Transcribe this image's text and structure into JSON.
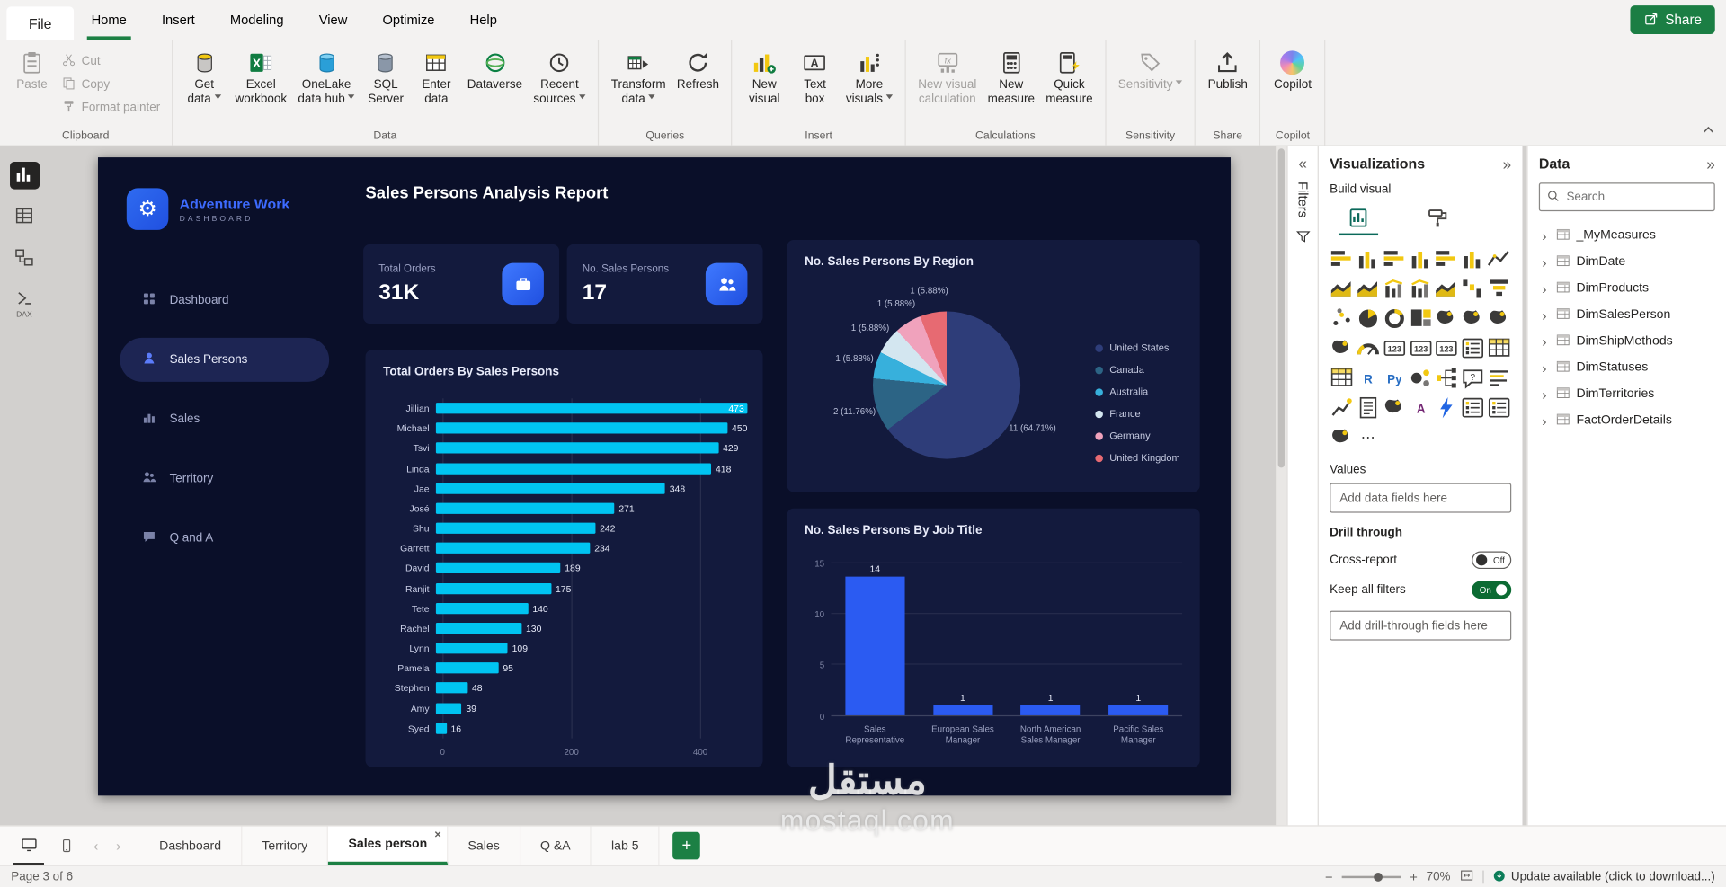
{
  "menubar": {
    "file_label": "File",
    "items": [
      "Home",
      "Insert",
      "Modeling",
      "View",
      "Optimize",
      "Help"
    ],
    "active_item": "Home",
    "share_label": "Share"
  },
  "ribbon": {
    "groups": [
      {
        "label": "Clipboard",
        "layout": "clipboard",
        "items": [
          {
            "label": "Paste",
            "icon": "paste",
            "disabled": true,
            "large": true
          },
          {
            "label": "Cut",
            "icon": "cut",
            "disabled": true
          },
          {
            "label": "Copy",
            "icon": "copy",
            "disabled": true
          },
          {
            "label": "Format painter",
            "icon": "format-painter",
            "disabled": true
          }
        ]
      },
      {
        "label": "Data",
        "items": [
          {
            "label": "Get\ndata",
            "icon": "get-data",
            "dropdown": true
          },
          {
            "label": "Excel\nworkbook",
            "icon": "excel"
          },
          {
            "label": "OneLake\ndata hub",
            "icon": "onelake",
            "dropdown": true
          },
          {
            "label": "SQL\nServer",
            "icon": "sql-server"
          },
          {
            "label": "Enter\ndata",
            "icon": "enter-data"
          },
          {
            "label": "Dataverse",
            "icon": "dataverse"
          },
          {
            "label": "Recent\nsources",
            "icon": "recent-sources",
            "dropdown": true
          }
        ]
      },
      {
        "label": "Queries",
        "items": [
          {
            "label": "Transform\ndata",
            "icon": "transform-data",
            "dropdown": true
          },
          {
            "label": "Refresh",
            "icon": "refresh"
          }
        ]
      },
      {
        "label": "Insert",
        "items": [
          {
            "label": "New\nvisual",
            "icon": "new-visual"
          },
          {
            "label": "Text\nbox",
            "icon": "text-box"
          },
          {
            "label": "More\nvisuals",
            "icon": "more-visuals",
            "dropdown": true
          }
        ]
      },
      {
        "label": "Calculations",
        "items": [
          {
            "label": "New visual\ncalculation",
            "icon": "new-visual-calculation",
            "disabled": true
          },
          {
            "label": "New\nmeasure",
            "icon": "new-measure"
          },
          {
            "label": "Quick\nmeasure",
            "icon": "quick-measure"
          }
        ]
      },
      {
        "label": "Sensitivity",
        "items": [
          {
            "label": "Sensitivity",
            "icon": "sensitivity",
            "disabled": true,
            "dropdown": true
          }
        ]
      },
      {
        "label": "Share",
        "items": [
          {
            "label": "Publish",
            "icon": "publish"
          }
        ]
      },
      {
        "label": "Copilot",
        "items": [
          {
            "label": "Copilot",
            "icon": "copilot"
          }
        ]
      }
    ]
  },
  "view_rail": {
    "items": [
      {
        "name": "report-view",
        "active": true
      },
      {
        "name": "table-view"
      },
      {
        "name": "model-view"
      },
      {
        "name": "dax-query-view",
        "label": "DAX"
      }
    ]
  },
  "dashboard": {
    "brand": {
      "title": "Adventure Work",
      "subtitle": "DASHBOARD"
    },
    "nav": [
      {
        "label": "Dashboard",
        "icon": "grid"
      },
      {
        "label": "Sales Persons",
        "icon": "person",
        "active": true
      },
      {
        "label": "Sales",
        "icon": "chart"
      },
      {
        "label": "Territory",
        "icon": "territory"
      },
      {
        "label": "Q and A",
        "icon": "chat"
      }
    ],
    "title": "Sales Persons Analysis Report",
    "kpis": [
      {
        "label": "Total Orders",
        "value": "31K",
        "icon": "briefcase"
      },
      {
        "label": "No. Sales Persons",
        "value": "17",
        "icon": "people"
      }
    ]
  },
  "chart_data": [
    {
      "type": "bar",
      "orientation": "horizontal",
      "title": "Total Orders By Sales Persons",
      "categories": [
        "Jillian",
        "Michael",
        "Tsvi",
        "Linda",
        "Jae",
        "José",
        "Shu",
        "Garrett",
        "David",
        "Ranjit",
        "Tete",
        "Rachel",
        "Lynn",
        "Pamela",
        "Stephen",
        "Amy",
        "Syed"
      ],
      "values": [
        473,
        450,
        429,
        418,
        348,
        271,
        242,
        234,
        189,
        175,
        140,
        130,
        109,
        95,
        48,
        39,
        16
      ],
      "xlim": [
        0,
        473
      ],
      "x_ticks": [
        0,
        200,
        400
      ],
      "bar_color": "#00c4f2"
    },
    {
      "type": "pie",
      "title": "No. Sales Persons By Region",
      "legend_position": "right",
      "slices": [
        {
          "label": "United States",
          "value": 11,
          "data_label": "11 (64.71%)",
          "color": "#2e3d79"
        },
        {
          "label": "Canada",
          "value": 2,
          "data_label": "2 (11.76%)",
          "color": "#2c6485"
        },
        {
          "label": "Australia",
          "value": 1,
          "data_label": "1 (5.88%)",
          "color": "#37b0dc"
        },
        {
          "label": "France",
          "value": 1,
          "data_label": "1 (5.88%)",
          "color": "#d3e6f0"
        },
        {
          "label": "Germany",
          "value": 1,
          "data_label": "1 (5.88%)",
          "color": "#f0a2bc"
        },
        {
          "label": "United Kingdom",
          "value": 1,
          "data_label": "1 (5.88%)",
          "color": "#e76a72"
        }
      ]
    },
    {
      "type": "bar",
      "orientation": "vertical",
      "title": "No. Sales Persons By Job Title",
      "categories": [
        "Sales Representative",
        "European Sales Manager",
        "North American Sales Manager",
        "Pacific Sales Manager"
      ],
      "x_labels": [
        [
          "Sales",
          "Representative"
        ],
        [
          "European Sales",
          "Manager"
        ],
        [
          "North American",
          "Sales Manager"
        ],
        [
          "Pacific Sales",
          "Manager"
        ]
      ],
      "values": [
        14,
        1,
        1,
        1
      ],
      "ylim": [
        0,
        15
      ],
      "y_ticks": [
        0,
        5,
        10,
        15
      ],
      "bar_color": "#2b5bf2"
    }
  ],
  "filters_strip": {
    "title": "Filters"
  },
  "viz_panel": {
    "title": "Visualizations",
    "build_label": "Build visual",
    "modes": [
      {
        "name": "build-visual",
        "active": true
      },
      {
        "name": "format-visual"
      }
    ],
    "icons": [
      "stacked-bar-chart",
      "stacked-column-chart",
      "clustered-bar-chart",
      "clustered-column-chart",
      "100-stacked-bar-chart",
      "100-stacked-column-chart",
      "line-chart",
      "area-chart",
      "stacked-area-chart",
      "line-and-stacked-column-chart",
      "line-and-clustered-column-chart",
      "ribbon-chart",
      "waterfall-chart",
      "funnel-chart",
      "scatter-chart",
      "pie-chart",
      "donut-chart",
      "treemap",
      "map",
      "filled-map",
      "shape-map",
      "azure-map",
      "gauge",
      "card",
      "multi-row-card",
      "kpi",
      "slicer",
      "table",
      "matrix",
      "r-script-visual",
      "python-visual",
      "key-influencers",
      "decomposition-tree",
      "qna-visual",
      "smart-narrative",
      "metrics",
      "paginated-report",
      "arcgis-map",
      "power-apps-visual",
      "power-automate-visual",
      "button-slicer",
      "text-slicer",
      "relationship-map"
    ],
    "values_label": "Values",
    "values_placeholder": "Add data fields here",
    "drill_label": "Drill through",
    "cross_report_label": "Cross-report",
    "cross_report_state": "Off",
    "keep_filters_label": "Keep all filters",
    "keep_filters_state": "On",
    "drill_placeholder": "Add drill-through fields here"
  },
  "data_panel": {
    "title": "Data",
    "search_placeholder": "Search",
    "tables": [
      "_MyMeasures",
      "DimDate",
      "DimProducts",
      "DimSalesPerson",
      "DimShipMethods",
      "DimStatuses",
      "DimTerritories",
      "FactOrderDetails"
    ]
  },
  "page_tabs": {
    "tabs": [
      "Dashboard",
      "Territory",
      "Sales person",
      "Sales",
      "Q &A",
      "lab 5"
    ],
    "active": "Sales person"
  },
  "status_bar": {
    "left": "Page 3 of 6",
    "zoom": "70%",
    "update": "Update available (click to download...)"
  },
  "watermark": {
    "logo": "مستقل",
    "domain": "mostaql.com"
  }
}
